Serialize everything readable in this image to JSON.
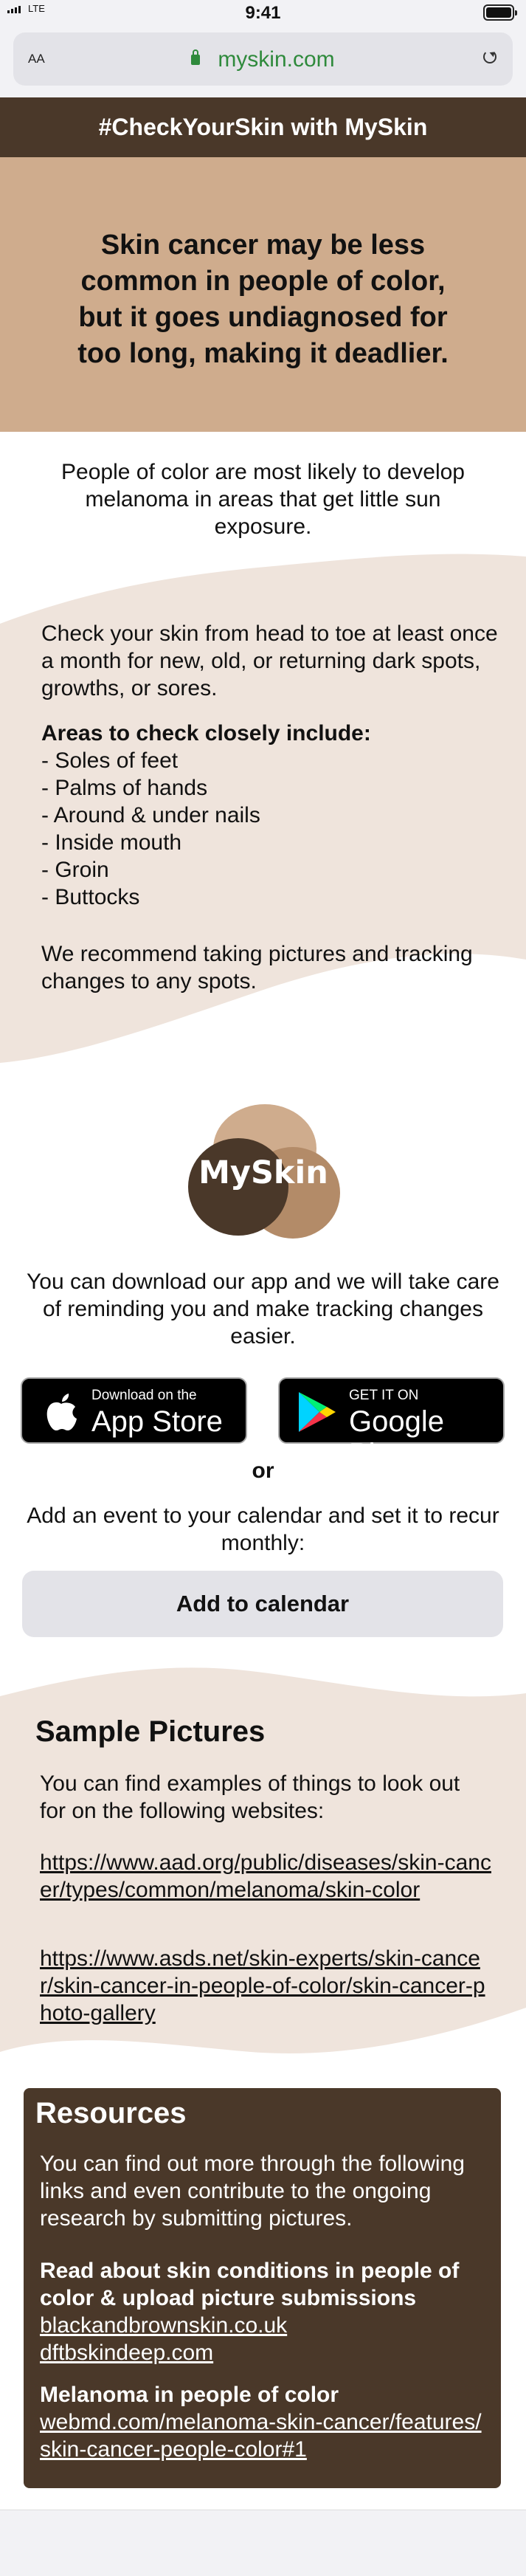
{
  "status_bar": {
    "carrier": "LTE",
    "time": "9:41",
    "battery_percent": 100
  },
  "browser": {
    "text_size_button": "AA",
    "url": "myskin.com"
  },
  "banner": {
    "title": "#CheckYourSkin with MySkin"
  },
  "hero": {
    "text": "Skin cancer may be less common in people of color, but it goes undiagnosed for too long, making it deadlier."
  },
  "intro": {
    "text": "People of color are most likely to develop melanoma in areas that get little sun exposure."
  },
  "checklist": {
    "intro": "Check your skin from head to toe at least once a month for new, old, or returning dark spots, growths, or sores.",
    "heading": "Areas to check closely include:",
    "areas": [
      "- Soles of feet",
      "- Palms of hands",
      "- Around & under nails",
      "- Inside mouth",
      "- Groin",
      "- Buttocks"
    ],
    "recommendation": "We recommend taking pictures and tracking changes to any spots."
  },
  "logo": {
    "text": "MySkin"
  },
  "app": {
    "text": "You can download our app and we will take care of reminding you and make tracking changes easier.",
    "appstore_small": "Download on the",
    "appstore_big": "App Store",
    "googleplay_small": "GET IT ON",
    "googleplay_big": "Google Play"
  },
  "calendar": {
    "or": "or",
    "text": "Add an event to your calendar and set it to recur monthly:",
    "button": "Add to calendar"
  },
  "samples": {
    "title": "Sample Pictures",
    "text": "You can find examples of things to look out for on the following websites:",
    "links": [
      "https://www.aad.org/public/diseases/skin-cancer/types/common/melanoma/skin-color",
      "https://www.asds.net/skin-experts/skin-cancer/skin-cancer-in-people-of-color/skin-cancer-photo-gallery"
    ]
  },
  "resources": {
    "title": "Resources",
    "text": "You can find out more through the following links and even contribute to the ongoing research by submitting pictures.",
    "section1_heading": "Read about skin conditions in people of color & upload picture submissions",
    "section1_links": [
      "blackandbrownskin.co.uk",
      "dftbskindeep.com"
    ],
    "section2_heading": "Melanoma in people of color",
    "section2_link": "webmd.com/melanoma-skin-cancer/features/skin-cancer-people-color#1"
  },
  "colors": {
    "dark_brown": "#4a3829",
    "tan": "#cfac8d",
    "beige": "#efe4dc",
    "url_green": "#2f8a3c"
  }
}
